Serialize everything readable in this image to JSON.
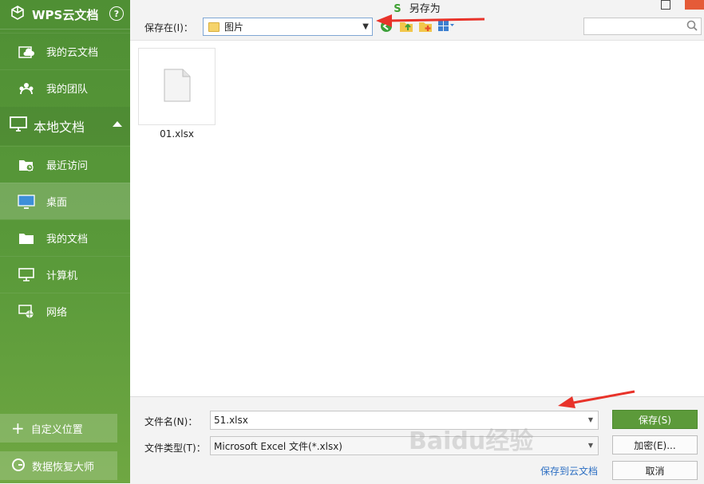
{
  "sidebar": {
    "brand": "WPS云文档",
    "help": "?",
    "cloud_items": [
      {
        "label": "我的云文档",
        "icon": "cloud-doc-icon"
      },
      {
        "label": "我的团队",
        "icon": "team-icon"
      }
    ],
    "local_section": {
      "label": "本地文档",
      "icon": "monitor-icon"
    },
    "local_items": [
      {
        "label": "最近访问",
        "icon": "recent-icon"
      },
      {
        "label": "桌面",
        "icon": "desktop-icon"
      },
      {
        "label": "我的文档",
        "icon": "folder-icon"
      },
      {
        "label": "计算机",
        "icon": "computer-icon"
      },
      {
        "label": "网络",
        "icon": "network-icon"
      }
    ],
    "custom_location": "自定义位置",
    "data_recovery": "数据恢复大师"
  },
  "dialog": {
    "title_icon": "S",
    "title": "另存为",
    "save_in_label": "保存在(I)：",
    "save_in_value": "图片",
    "search_placeholder": ""
  },
  "files": [
    {
      "name": "01.xlsx",
      "icon": "file-icon"
    }
  ],
  "bottom": {
    "filename_label": "文件名(N)：",
    "filename_value": "51.xlsx",
    "filetype_label": "文件类型(T)：",
    "filetype_value": "Microsoft Excel 文件(*.xlsx)",
    "save_button": "保存(S)",
    "encrypt_button": "加密(E)...",
    "cancel_button": "取消",
    "save_to_cloud": "保存到云文档"
  },
  "watermark": "Baidu经验",
  "colors": {
    "sidebar_green": "#5a9a3a",
    "primary_button": "#5c9a3a",
    "close_red": "#e55b38",
    "link_blue": "#2d6fc3",
    "annotation_red": "#e8332a"
  }
}
